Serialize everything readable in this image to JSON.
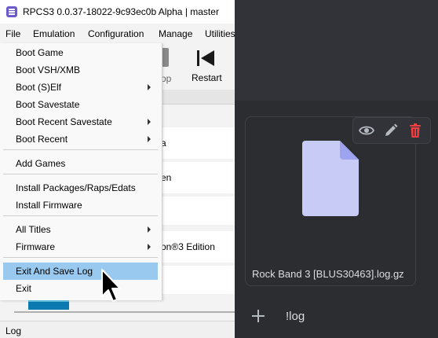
{
  "window": {
    "title": "RPCS3 0.0.37-18022-9c93ec0b Alpha | master"
  },
  "menubar": {
    "items": [
      "File",
      "Emulation",
      "Configuration",
      "Manage",
      "Utilities"
    ]
  },
  "toolbar": {
    "stop_label_partial": "op",
    "restart_label": "Restart"
  },
  "file_menu": {
    "items": [
      "Boot Game",
      "Boot VSH/XMB",
      "Boot (S)Elf",
      "Boot Savestate",
      "Boot Recent Savestate",
      "Boot Recent",
      "Add Games",
      "Install Packages/Raps/Edats",
      "Install Firmware",
      "All Titles",
      "Firmware",
      "Exit And Save Log",
      "Exit"
    ]
  },
  "game_list": {
    "cells": [
      "a",
      "en",
      "on®3 Edition"
    ]
  },
  "statusbar": {
    "text": "Log"
  },
  "attachment": {
    "filename": "Rock Band 3 [BLUS30463].log.gz"
  },
  "composer": {
    "text": "!log"
  },
  "colors": {
    "delete_red": "#f23f42",
    "doc_fill": "#c9cbf7",
    "doc_fold": "#9ea3f0",
    "highlight": "#99c9ef"
  },
  "icons": [
    "view-icon",
    "edit-icon",
    "delete-icon",
    "document-icon",
    "add-icon",
    "stop-icon",
    "restart-icon",
    "chevron-right-icon",
    "mouse-cursor-icon"
  ]
}
